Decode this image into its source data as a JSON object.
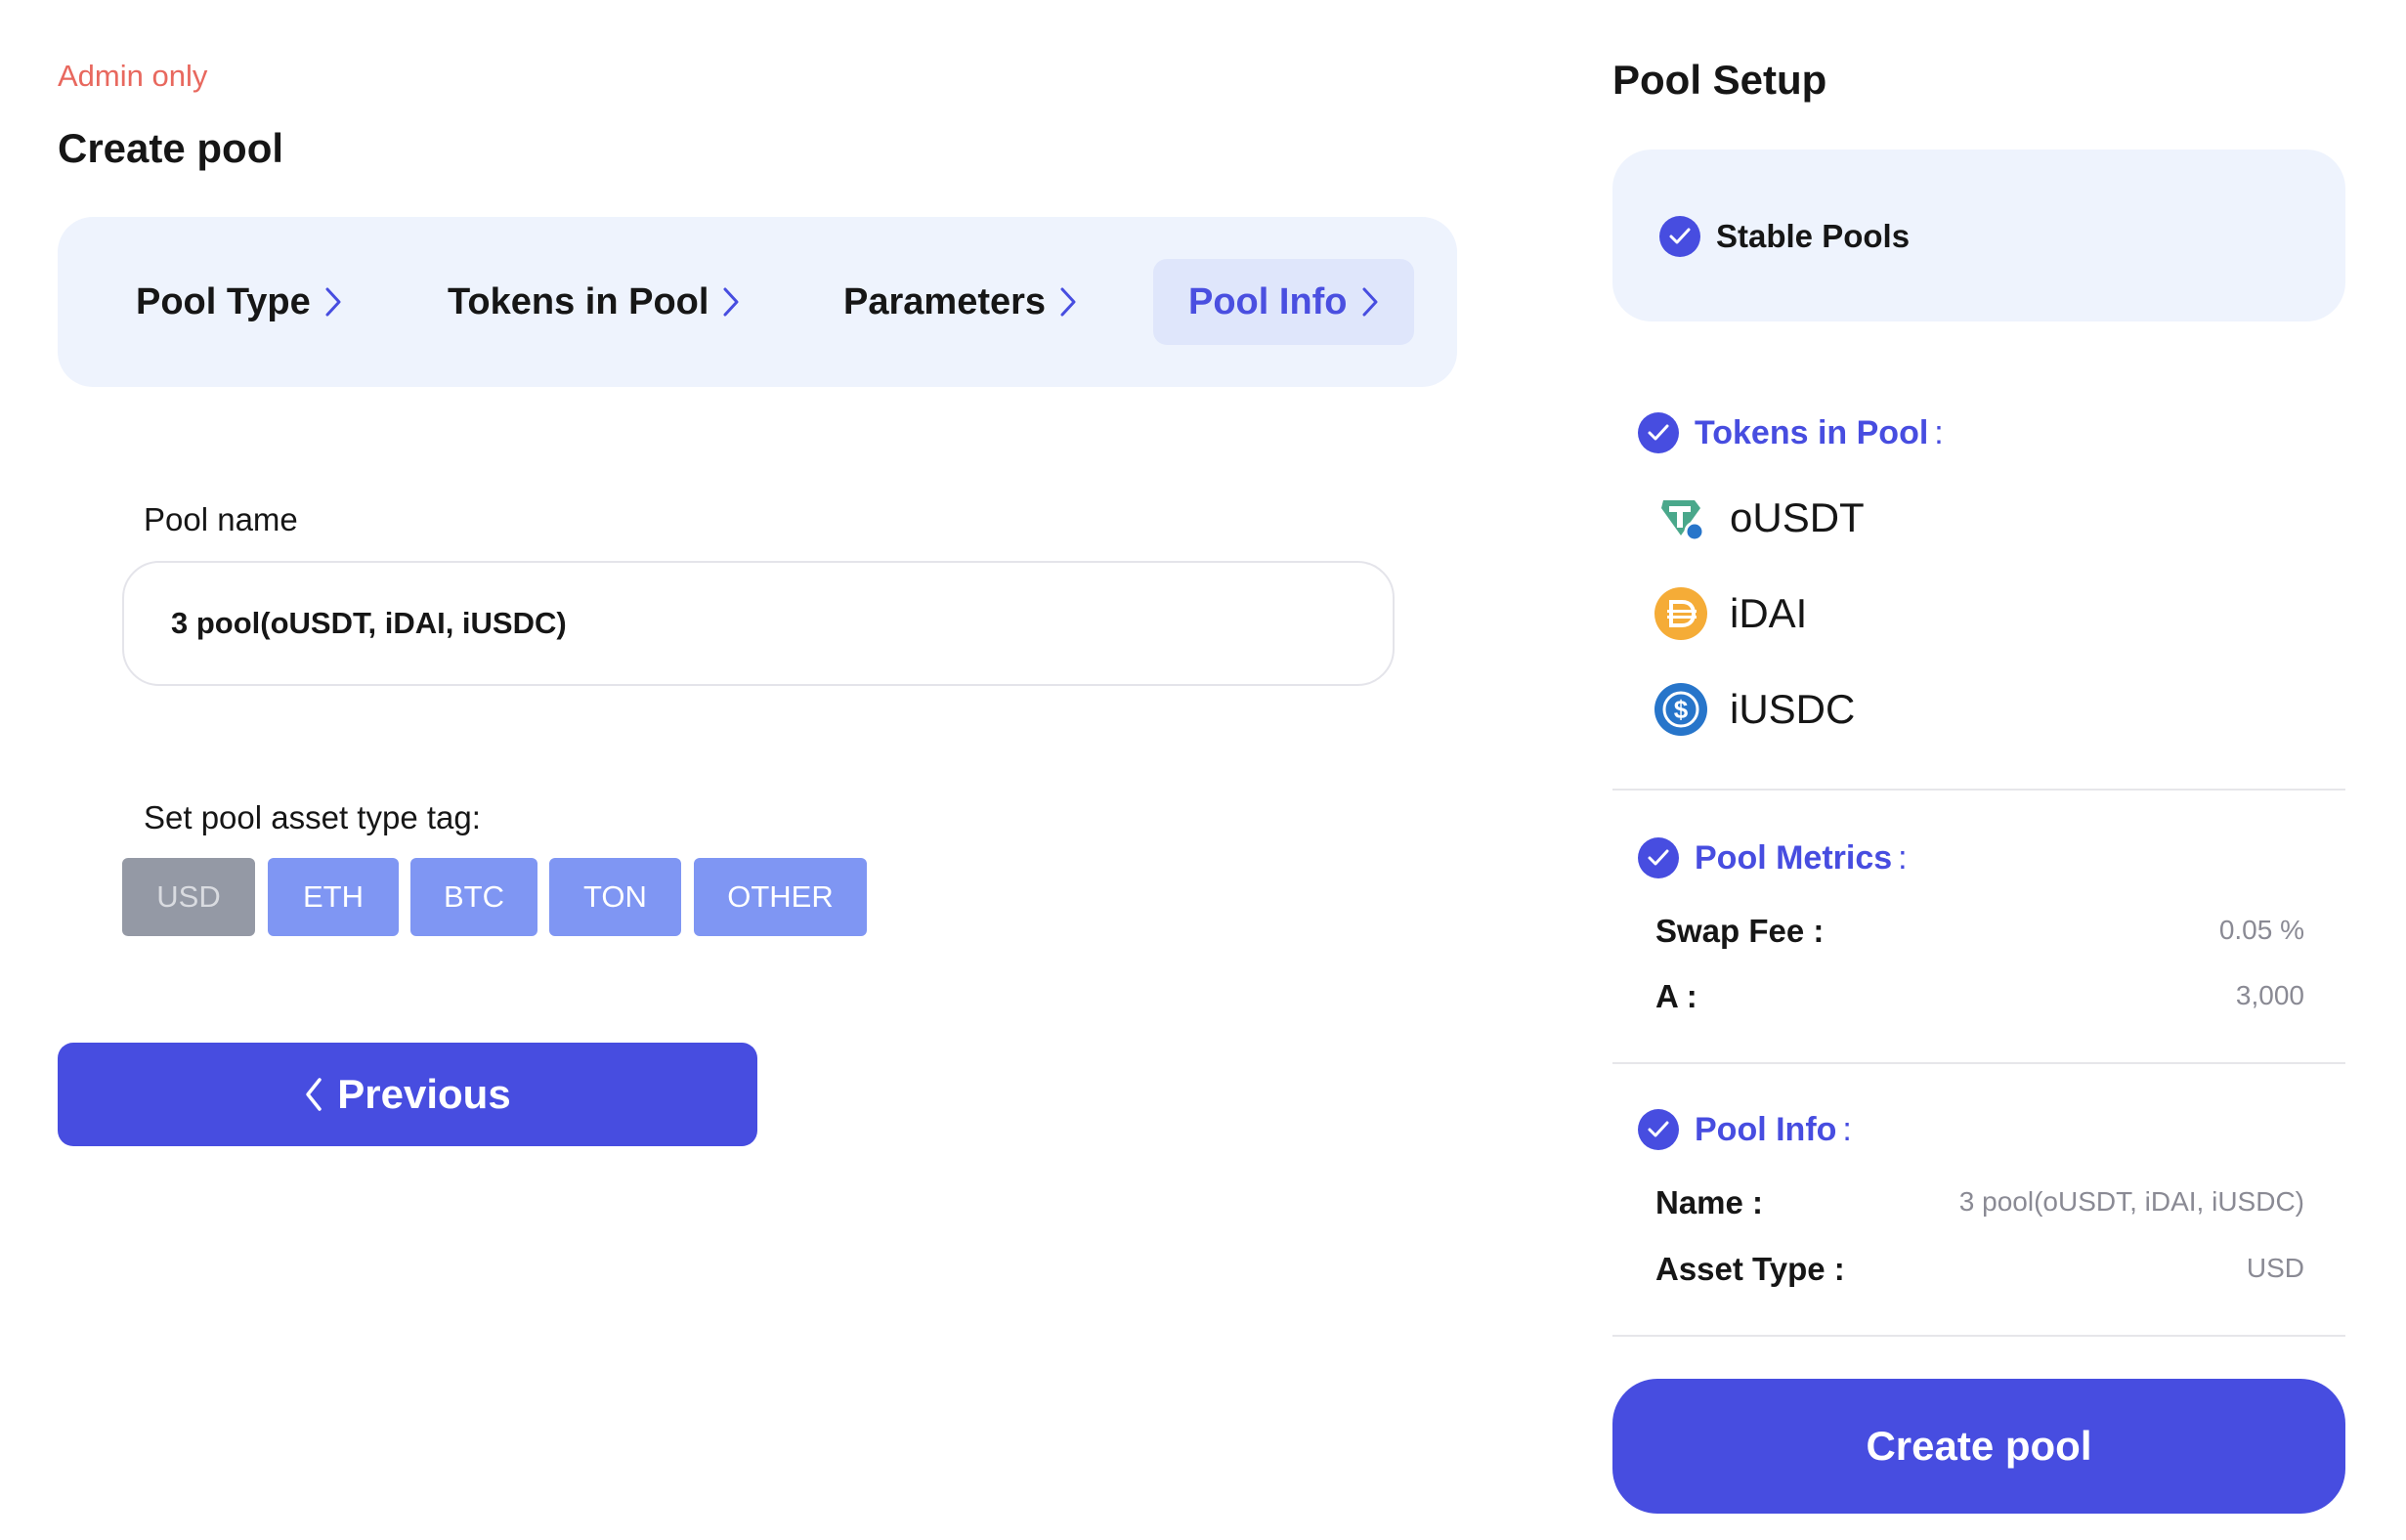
{
  "header": {
    "admin_label": "Admin only",
    "title": "Create pool"
  },
  "stepper": {
    "steps": [
      {
        "label": "Pool Type"
      },
      {
        "label": "Tokens in Pool"
      },
      {
        "label": "Parameters"
      },
      {
        "label": "Pool Info"
      }
    ],
    "active_step": "Pool Info"
  },
  "form": {
    "pool_name_label": "Pool name",
    "pool_name_value": "3 pool(oUSDT, iDAI, iUSDC)",
    "tag_label": "Set pool asset type tag:",
    "tags": [
      "USD",
      "ETH",
      "BTC",
      "TON",
      "OTHER"
    ],
    "selected_tag": "USD",
    "previous_label": "Previous"
  },
  "summary": {
    "title": "Pool Setup",
    "pool_type": "Stable Pools",
    "tokens_heading": "Tokens in Pool",
    "tokens": [
      {
        "symbol": "oUSDT",
        "icon": "tether-icon",
        "color": "#4aa88b"
      },
      {
        "symbol": "iDAI",
        "icon": "dai-icon",
        "color": "#f5ac37"
      },
      {
        "symbol": "iUSDC",
        "icon": "usdc-icon",
        "color": "#2775ca"
      }
    ],
    "metrics_heading": "Pool Metrics",
    "metrics": {
      "swap_fee_label": "Swap Fee :",
      "swap_fee_value": "0.05 %",
      "a_label": "A :",
      "a_value": "3,000"
    },
    "info_heading": "Pool Info",
    "info": {
      "name_label": "Name :",
      "name_value": "3 pool(oUSDT, iDAI, iUSDC)",
      "asset_type_label": "Asset Type :",
      "asset_type_value": "USD"
    },
    "colon": ":",
    "create_label": "Create pool"
  },
  "colors": {
    "accent": "#474de0",
    "admin_red": "#e8685e",
    "panel_bg": "#eef3fd",
    "tag_bg": "#7f96f3",
    "tag_selected_bg": "#9499a5"
  }
}
